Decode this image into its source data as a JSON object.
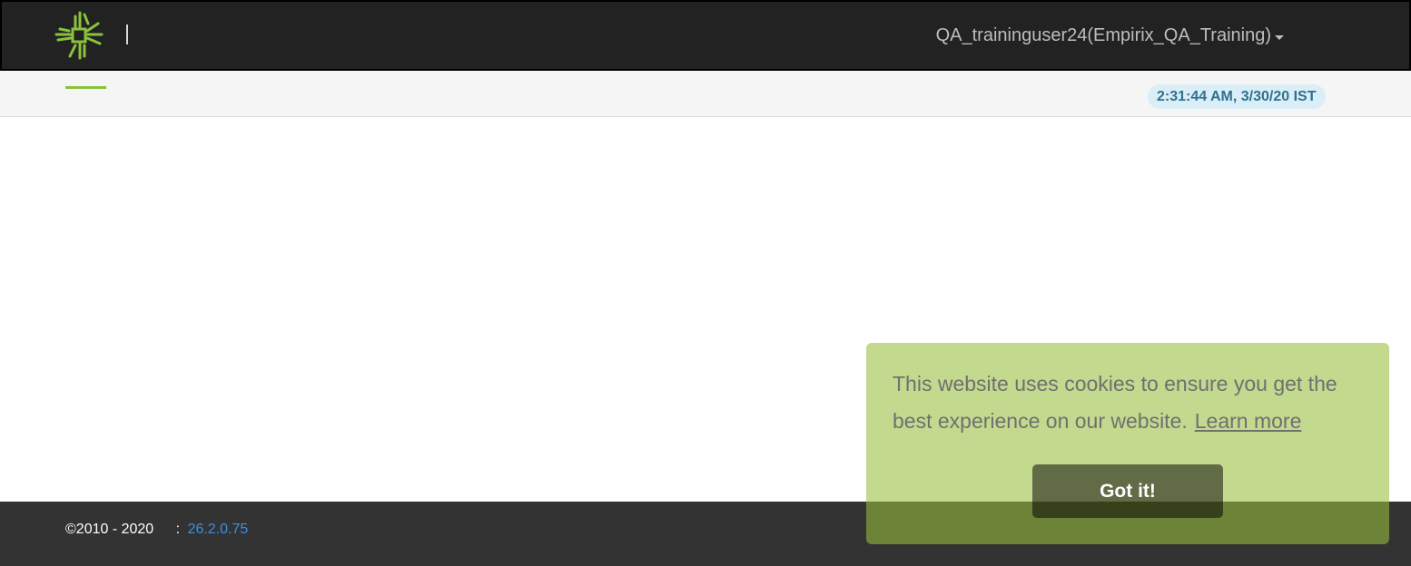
{
  "header": {
    "user_menu_label": "QA_traininguser24(Empirix_QA_Training)",
    "brand_color": "#8ac23c"
  },
  "subheader": {
    "clock": "2:31:44 AM, 3/30/20 IST"
  },
  "footer": {
    "copyright": "©2010 - 2020",
    "version_separator": ":",
    "version": "26.2.0.75"
  },
  "cookie_banner": {
    "message": "This website uses cookies to ensure you get the best experience on our website.",
    "learn_more_label": "Learn more",
    "accept_label": "Got it!"
  },
  "icons": {
    "logo": "empirix-logo-icon",
    "user_menu_caret": "caret-down-icon"
  }
}
